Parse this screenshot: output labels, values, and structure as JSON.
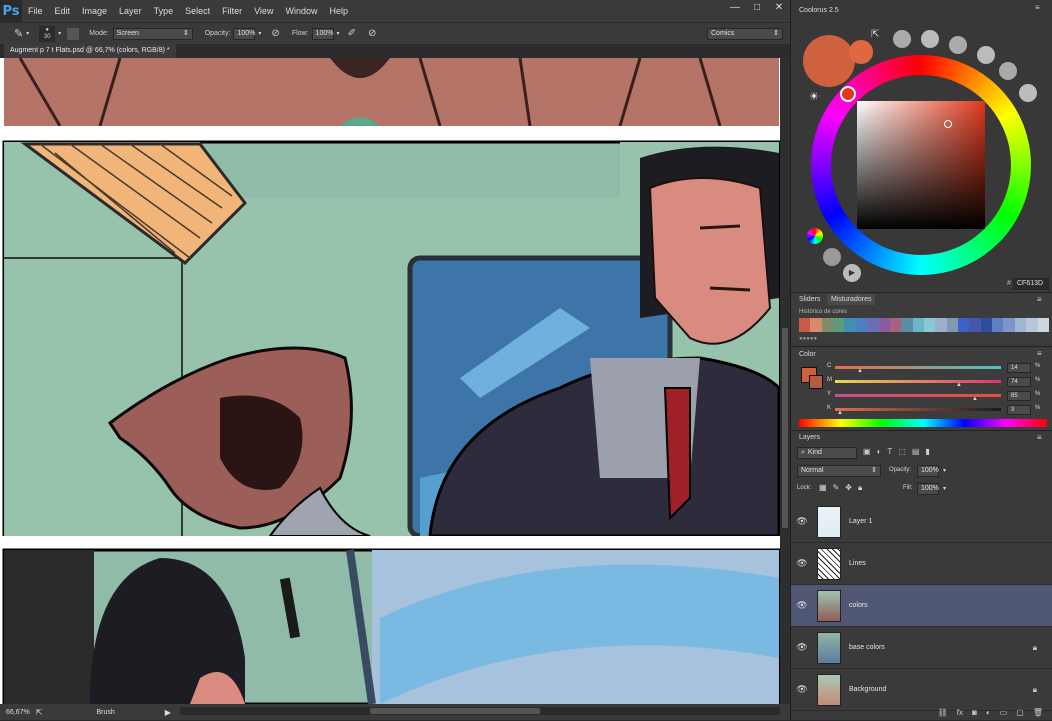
{
  "app": {
    "logo": "Ps"
  },
  "menu": [
    "File",
    "Edit",
    "Image",
    "Layer",
    "Type",
    "Select",
    "Filter",
    "View",
    "Window",
    "Help"
  ],
  "window_buttons": [
    "—",
    "□",
    "✕"
  ],
  "options": {
    "brush_size": "30",
    "mode_label": "Mode:",
    "mode_value": "Screen",
    "opacity_label": "Opacity:",
    "opacity_value": "100%",
    "flow_label": "Flow:",
    "flow_value": "100%",
    "workspace": "Comics"
  },
  "document": {
    "tab_title": "Augment p 7 t Flats.psd @ 66,7% (colors, RGB/8) *"
  },
  "status": {
    "zoom": "66,67%",
    "tool": "Brush"
  },
  "coolorus": {
    "title": "Coolorus 2.5",
    "hex": "CF613D",
    "current_color": "#cf613d"
  },
  "mixer": {
    "tabs": [
      "Sliders",
      "Misturadores"
    ],
    "history_label": "Histórico de cores",
    "swatches": [
      "#c95a45",
      "#d98a6e",
      "#7d8f6a",
      "#5e9a7c",
      "#3f8fb0",
      "#4d7dc2",
      "#6a6fb5",
      "#8a5aa3",
      "#a8617e",
      "#5b8da8",
      "#6bb7c9",
      "#89c8d4",
      "#9ab0c8",
      "#7f9ab0",
      "#3963c9",
      "#4b55a8",
      "#2e4fa0",
      "#5e7fc4",
      "#7d95c8",
      "#9fb5d4",
      "#b8c8d8",
      "#cfd8e0"
    ]
  },
  "color_panel": {
    "title": "Color",
    "channels": [
      {
        "label": "C",
        "value": "14"
      },
      {
        "label": "M",
        "value": "74"
      },
      {
        "label": "Y",
        "value": "85"
      },
      {
        "label": "K",
        "value": "3"
      }
    ]
  },
  "layers_panel": {
    "title": "Layers",
    "filter": "Kind",
    "blend_mode": "Normal",
    "opacity_label": "Opacity:",
    "opacity_value": "100%",
    "lock_label": "Lock:",
    "fill_label": "Fill:",
    "fill_value": "100%",
    "layers": [
      {
        "name": "Layer 1",
        "locked": false,
        "selected": false
      },
      {
        "name": "Lines",
        "locked": false,
        "selected": false
      },
      {
        "name": "colors",
        "locked": false,
        "selected": true
      },
      {
        "name": "base colors",
        "locked": true,
        "selected": false
      },
      {
        "name": "Background",
        "locked": true,
        "selected": false
      }
    ]
  }
}
